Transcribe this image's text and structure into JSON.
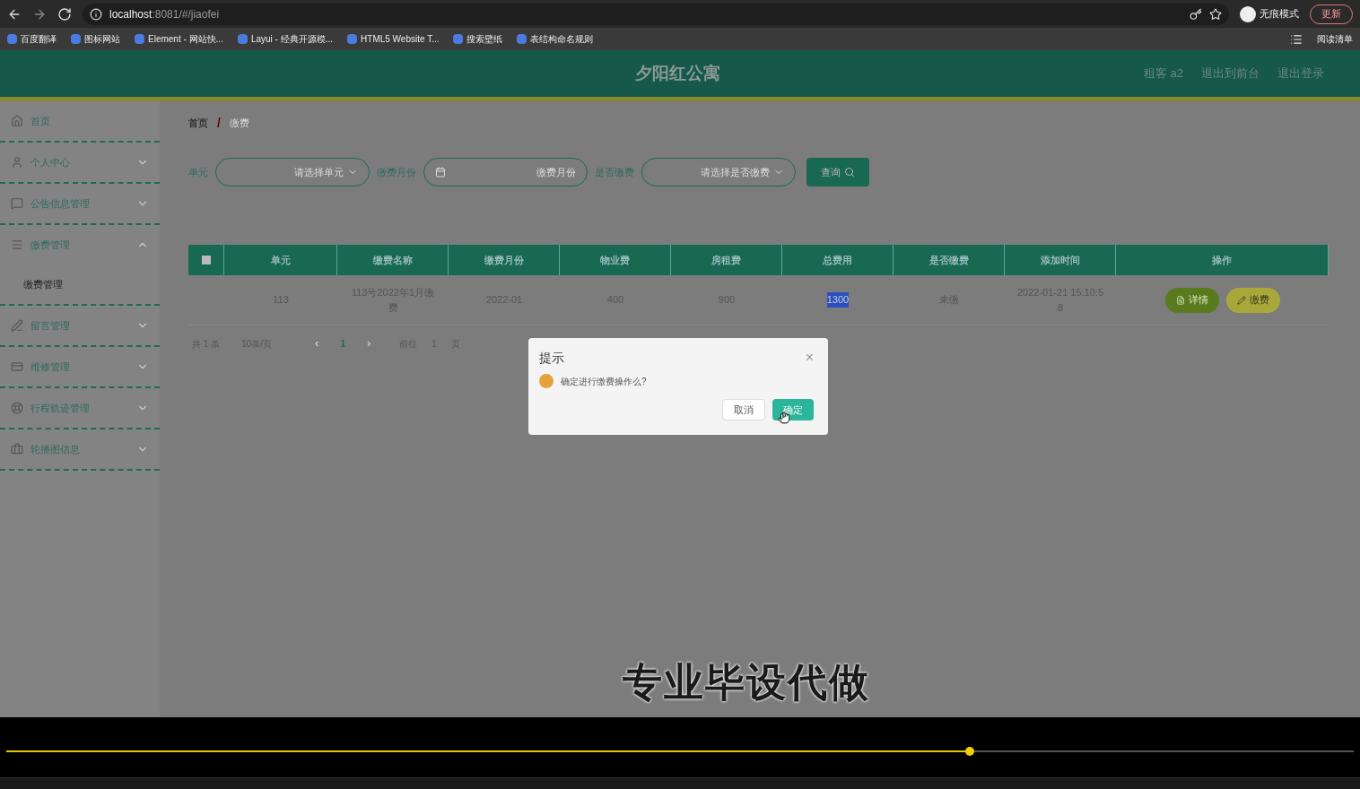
{
  "browser": {
    "url_host": "localhost",
    "url_path": ":8081/#/jiaofei",
    "incognito": "无痕模式",
    "update_button": "更新",
    "bookmarks": [
      "百度翻译",
      "图标网站",
      "Element - 网站快...",
      "Layui - 经典开源模...",
      "HTML5 Website T...",
      "搜索壁纸",
      "表结构命名规则"
    ],
    "reading_list": "阅读清单"
  },
  "header": {
    "title": "夕阳红公寓",
    "links": [
      "租客 a2",
      "退出到前台",
      "退出登录"
    ]
  },
  "sidebar": {
    "items": [
      {
        "label": "首页"
      },
      {
        "label": "个人中心",
        "expanded": false
      },
      {
        "label": "公告信息管理",
        "expanded": false
      },
      {
        "label": "缴费管理",
        "expanded": true,
        "children": [
          {
            "label": "缴费管理",
            "selected": true
          }
        ]
      },
      {
        "label": "留言管理",
        "expanded": false
      },
      {
        "label": "维修管理",
        "expanded": false
      },
      {
        "label": "行程轨迹管理",
        "expanded": false
      },
      {
        "label": "轮播图信息",
        "expanded": false
      }
    ]
  },
  "breadcrumb": [
    "首页",
    "缴费"
  ],
  "breadcrumb_separator": "/",
  "filters": [
    {
      "label": "单元",
      "placeholder": "请选择单元",
      "kind": "select"
    },
    {
      "label": "缴费月份",
      "placeholder": "缴费月份",
      "kind": "date"
    },
    {
      "label": "是否缴费",
      "placeholder": "请选择是否缴费",
      "kind": "select"
    }
  ],
  "search_button": "查询",
  "table": {
    "select_all_checked": false,
    "columns": [
      "单元",
      "缴费名称",
      "缴费月份",
      "物业费",
      "房租费",
      "总费用",
      "是否缴费",
      "添加时间",
      "操作"
    ],
    "rows": [
      {
        "cells": [
          {
            "text": "113",
            "highlighted": false
          },
          {
            "text": "113号2022年1月缴费",
            "highlighted": false
          },
          {
            "text": "2022-01",
            "highlighted": false
          },
          {
            "text": "400",
            "highlighted": false
          },
          {
            "text": "900",
            "highlighted": false
          },
          {
            "text": "1300",
            "highlighted": true
          },
          {
            "text": "未缴",
            "highlighted": false
          },
          {
            "text": "2022-01-21 15:10:58",
            "highlighted": false
          }
        ],
        "actions": [
          {
            "label": "详情",
            "kind": "detail"
          },
          {
            "label": "缴费",
            "kind": "pay"
          }
        ]
      }
    ]
  },
  "pagination": {
    "total": "共 1 条",
    "page_size": "10条/页",
    "prev": "‹",
    "pages": [
      {
        "label": "1",
        "selected": true
      }
    ],
    "next": "›",
    "goto_label": "前往",
    "goto_value": "1",
    "goto_suffix": "页"
  },
  "dialog": {
    "title": "提示",
    "close": "×",
    "message": "确定进行缴费操作么?",
    "buttons": [
      {
        "label": "取消",
        "kind": "cancel"
      },
      {
        "label": "确定",
        "kind": "confirm"
      }
    ]
  },
  "video": {
    "caption": "专业毕设代做",
    "progress": {
      "level": 0.715
    }
  }
}
